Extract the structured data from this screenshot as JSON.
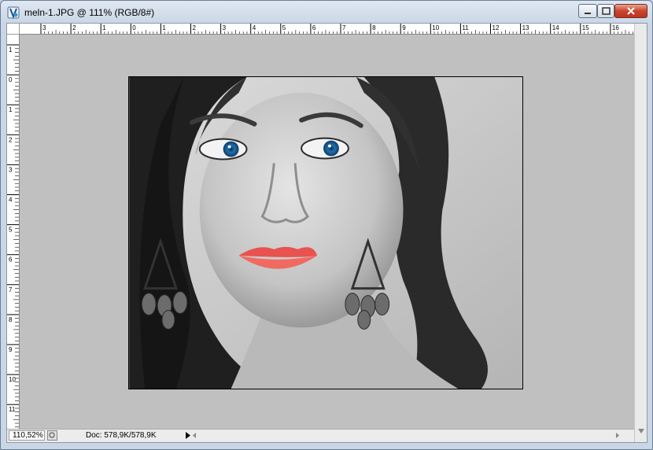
{
  "window": {
    "title": "meln-1.JPG @ 111% (RGB/8#)",
    "icon": "photoshop-document-icon",
    "controls": [
      "minimize-icon",
      "maximize-icon",
      "close-icon"
    ],
    "close_color": "#c9452d"
  },
  "rulers": {
    "horizontal_labels": [
      "3",
      "2",
      "1",
      "0",
      "1",
      "2",
      "3",
      "4",
      "5",
      "6",
      "7",
      "8",
      "9",
      "10",
      "11",
      "12",
      "13",
      "14",
      "15",
      "16"
    ],
    "vertical_labels": [
      "1",
      "0",
      "1",
      "2",
      "3",
      "4",
      "5",
      "6",
      "7",
      "8",
      "9",
      "10",
      "11"
    ]
  },
  "canvas": {
    "background": "#c0c0c0",
    "image_description": "black and white portrait with blue eyes and red lips",
    "accent_colors": {
      "eyes": "#1e6fb0",
      "lips": "#e8524f"
    }
  },
  "status": {
    "zoom": "110,52%",
    "doc_info": "Doc: 578,9K/578,9K"
  }
}
